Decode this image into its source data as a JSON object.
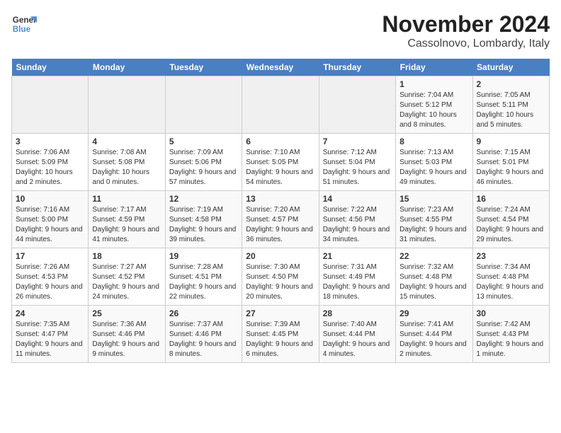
{
  "logo": {
    "line1": "General",
    "line2": "Blue"
  },
  "title": "November 2024",
  "subtitle": "Cassolnovo, Lombardy, Italy",
  "days_of_week": [
    "Sunday",
    "Monday",
    "Tuesday",
    "Wednesday",
    "Thursday",
    "Friday",
    "Saturday"
  ],
  "weeks": [
    [
      {
        "day": "",
        "info": ""
      },
      {
        "day": "",
        "info": ""
      },
      {
        "day": "",
        "info": ""
      },
      {
        "day": "",
        "info": ""
      },
      {
        "day": "",
        "info": ""
      },
      {
        "day": "1",
        "info": "Sunrise: 7:04 AM\nSunset: 5:12 PM\nDaylight: 10 hours and 8 minutes."
      },
      {
        "day": "2",
        "info": "Sunrise: 7:05 AM\nSunset: 5:11 PM\nDaylight: 10 hours and 5 minutes."
      }
    ],
    [
      {
        "day": "3",
        "info": "Sunrise: 7:06 AM\nSunset: 5:09 PM\nDaylight: 10 hours and 2 minutes."
      },
      {
        "day": "4",
        "info": "Sunrise: 7:08 AM\nSunset: 5:08 PM\nDaylight: 10 hours and 0 minutes."
      },
      {
        "day": "5",
        "info": "Sunrise: 7:09 AM\nSunset: 5:06 PM\nDaylight: 9 hours and 57 minutes."
      },
      {
        "day": "6",
        "info": "Sunrise: 7:10 AM\nSunset: 5:05 PM\nDaylight: 9 hours and 54 minutes."
      },
      {
        "day": "7",
        "info": "Sunrise: 7:12 AM\nSunset: 5:04 PM\nDaylight: 9 hours and 51 minutes."
      },
      {
        "day": "8",
        "info": "Sunrise: 7:13 AM\nSunset: 5:03 PM\nDaylight: 9 hours and 49 minutes."
      },
      {
        "day": "9",
        "info": "Sunrise: 7:15 AM\nSunset: 5:01 PM\nDaylight: 9 hours and 46 minutes."
      }
    ],
    [
      {
        "day": "10",
        "info": "Sunrise: 7:16 AM\nSunset: 5:00 PM\nDaylight: 9 hours and 44 minutes."
      },
      {
        "day": "11",
        "info": "Sunrise: 7:17 AM\nSunset: 4:59 PM\nDaylight: 9 hours and 41 minutes."
      },
      {
        "day": "12",
        "info": "Sunrise: 7:19 AM\nSunset: 4:58 PM\nDaylight: 9 hours and 39 minutes."
      },
      {
        "day": "13",
        "info": "Sunrise: 7:20 AM\nSunset: 4:57 PM\nDaylight: 9 hours and 36 minutes."
      },
      {
        "day": "14",
        "info": "Sunrise: 7:22 AM\nSunset: 4:56 PM\nDaylight: 9 hours and 34 minutes."
      },
      {
        "day": "15",
        "info": "Sunrise: 7:23 AM\nSunset: 4:55 PM\nDaylight: 9 hours and 31 minutes."
      },
      {
        "day": "16",
        "info": "Sunrise: 7:24 AM\nSunset: 4:54 PM\nDaylight: 9 hours and 29 minutes."
      }
    ],
    [
      {
        "day": "17",
        "info": "Sunrise: 7:26 AM\nSunset: 4:53 PM\nDaylight: 9 hours and 26 minutes."
      },
      {
        "day": "18",
        "info": "Sunrise: 7:27 AM\nSunset: 4:52 PM\nDaylight: 9 hours and 24 minutes."
      },
      {
        "day": "19",
        "info": "Sunrise: 7:28 AM\nSunset: 4:51 PM\nDaylight: 9 hours and 22 minutes."
      },
      {
        "day": "20",
        "info": "Sunrise: 7:30 AM\nSunset: 4:50 PM\nDaylight: 9 hours and 20 minutes."
      },
      {
        "day": "21",
        "info": "Sunrise: 7:31 AM\nSunset: 4:49 PM\nDaylight: 9 hours and 18 minutes."
      },
      {
        "day": "22",
        "info": "Sunrise: 7:32 AM\nSunset: 4:48 PM\nDaylight: 9 hours and 15 minutes."
      },
      {
        "day": "23",
        "info": "Sunrise: 7:34 AM\nSunset: 4:48 PM\nDaylight: 9 hours and 13 minutes."
      }
    ],
    [
      {
        "day": "24",
        "info": "Sunrise: 7:35 AM\nSunset: 4:47 PM\nDaylight: 9 hours and 11 minutes."
      },
      {
        "day": "25",
        "info": "Sunrise: 7:36 AM\nSunset: 4:46 PM\nDaylight: 9 hours and 9 minutes."
      },
      {
        "day": "26",
        "info": "Sunrise: 7:37 AM\nSunset: 4:46 PM\nDaylight: 9 hours and 8 minutes."
      },
      {
        "day": "27",
        "info": "Sunrise: 7:39 AM\nSunset: 4:45 PM\nDaylight: 9 hours and 6 minutes."
      },
      {
        "day": "28",
        "info": "Sunrise: 7:40 AM\nSunset: 4:44 PM\nDaylight: 9 hours and 4 minutes."
      },
      {
        "day": "29",
        "info": "Sunrise: 7:41 AM\nSunset: 4:44 PM\nDaylight: 9 hours and 2 minutes."
      },
      {
        "day": "30",
        "info": "Sunrise: 7:42 AM\nSunset: 4:43 PM\nDaylight: 9 hours and 1 minute."
      }
    ]
  ]
}
